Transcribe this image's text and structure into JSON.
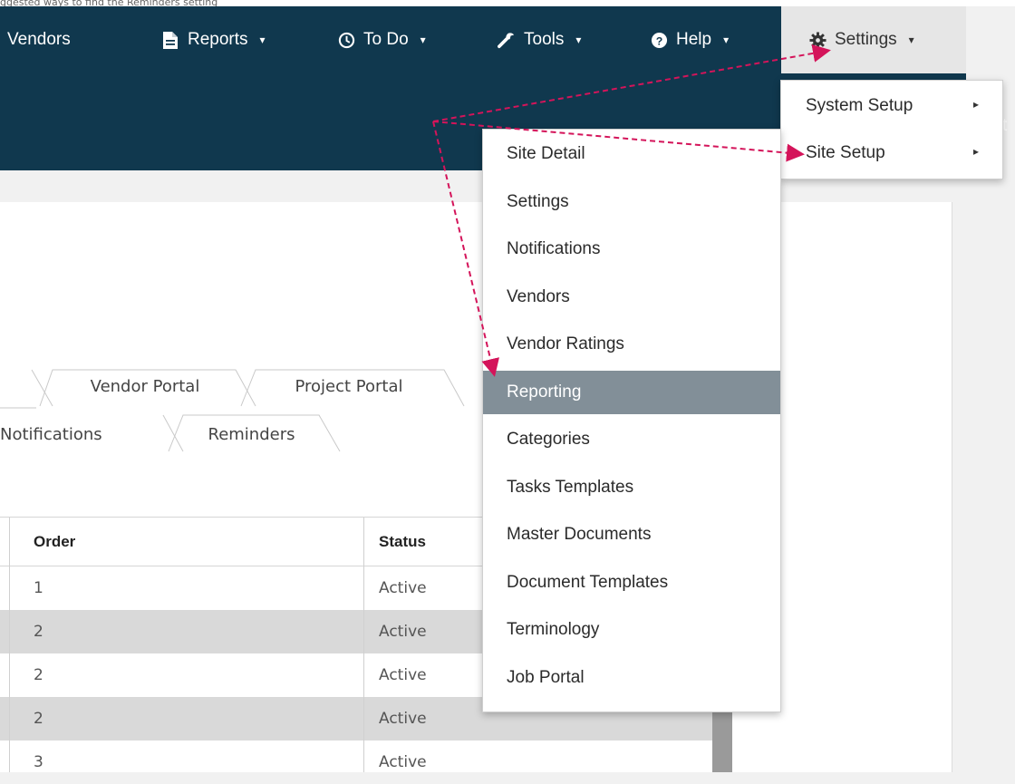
{
  "top_caption": "ggested ways to find the Reminders setting",
  "navbar": {
    "items": [
      {
        "label": "Vendors",
        "icon": ""
      },
      {
        "label": "Reports",
        "icon": "document-icon"
      },
      {
        "label": "To Do",
        "icon": "clock-icon"
      },
      {
        "label": "Tools",
        "icon": "wrench-icon"
      },
      {
        "label": "Help",
        "icon": "question-circle-icon"
      },
      {
        "label": "Settings",
        "icon": "gear-icon"
      }
    ],
    "caret": "▾",
    "right_edge_glyph": "t"
  },
  "settings_menu": {
    "items": [
      {
        "label": "System Setup",
        "caret": "▸"
      },
      {
        "label": "Site Setup",
        "caret": "▸"
      }
    ]
  },
  "site_setup_menu": {
    "items": [
      "Site Detail",
      "Settings",
      "Notifications",
      "Vendors",
      "Vendor Ratings",
      "Reporting",
      "Categories",
      "Tasks Templates",
      "Master Documents",
      "Document Templates",
      "Terminology",
      "Job Portal"
    ],
    "highlighted": "Reporting"
  },
  "tabs": {
    "row1": [
      "Vendor Portal",
      "Project Portal"
    ],
    "row2": [
      "Notifications",
      "Reminders"
    ]
  },
  "table": {
    "columns": [
      "Order",
      "Status"
    ],
    "rows": [
      {
        "order": "1",
        "status": "Active"
      },
      {
        "order": "2",
        "status": "Active"
      },
      {
        "order": "2",
        "status": "Active"
      },
      {
        "order": "2",
        "status": "Active"
      },
      {
        "order": "3",
        "status": "Active"
      }
    ]
  },
  "colors": {
    "navbar": "#10384e",
    "annotation_arrow": "#d4145a",
    "menu_highlight": "#828f98"
  }
}
